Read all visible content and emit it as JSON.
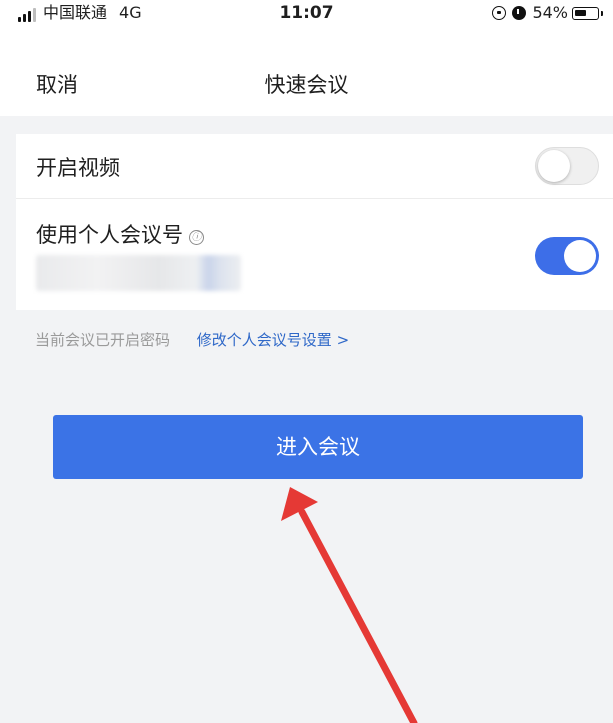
{
  "status_bar": {
    "carrier": "中国联通",
    "network": "4G",
    "time": "11:07",
    "battery_percent_text": "54%",
    "battery_level": 0.54,
    "icons": [
      "signal-icon",
      "rotation-lock-icon",
      "alarm-icon",
      "battery-icon"
    ]
  },
  "nav": {
    "cancel_label": "取消",
    "title": "快速会议"
  },
  "settings": {
    "video": {
      "label": "开启视频",
      "enabled": false
    },
    "personal_id": {
      "label": "使用个人会议号",
      "info_icon": "ⓘ",
      "enabled": true
    }
  },
  "hint": {
    "text": "当前会议已开启密码",
    "link": "修改个人会议号设置 >"
  },
  "enter_button": {
    "label": "进入会议"
  },
  "colors": {
    "accent": "#3b73e6",
    "toggle_on": "#3d6ee8",
    "link": "#2f68c8",
    "annotation_arrow": "#e53935"
  }
}
